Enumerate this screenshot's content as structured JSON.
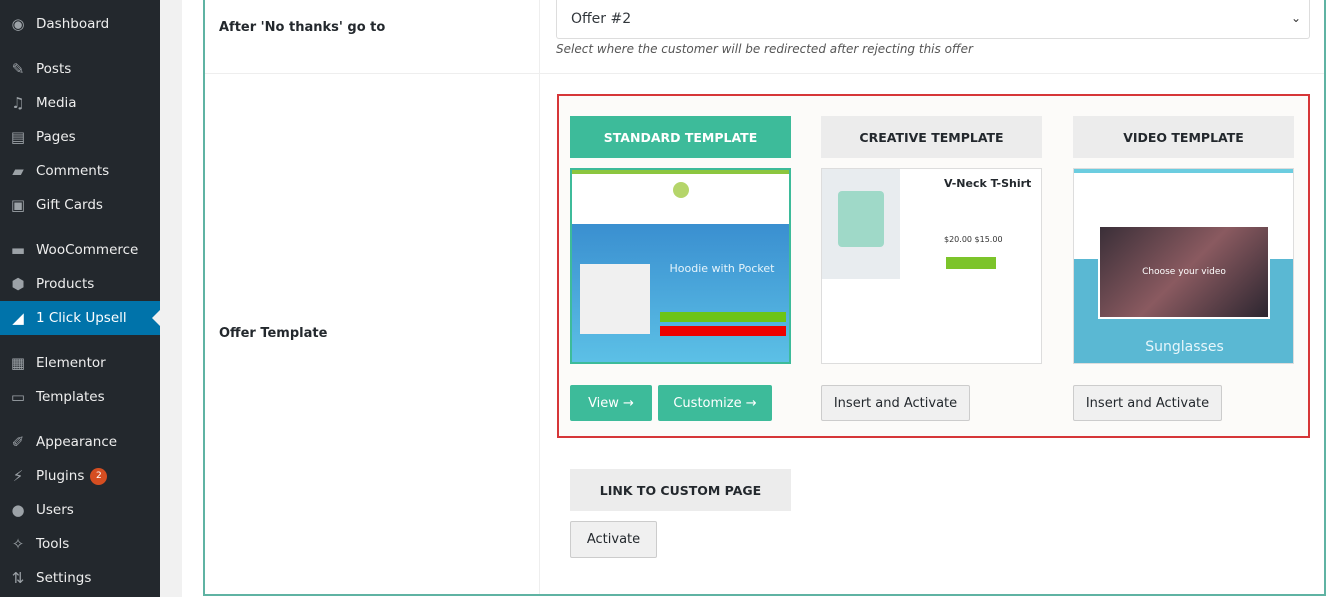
{
  "sidebar": {
    "items": [
      {
        "label": "Dashboard",
        "icon": "dashboard-icon",
        "glyph": "◉"
      },
      {
        "label": "Posts",
        "icon": "pin-icon",
        "glyph": "✎"
      },
      {
        "label": "Media",
        "icon": "media-icon",
        "glyph": "♫"
      },
      {
        "label": "Pages",
        "icon": "pages-icon",
        "glyph": "▤"
      },
      {
        "label": "Comments",
        "icon": "comment-icon",
        "glyph": "▰"
      },
      {
        "label": "Gift Cards",
        "icon": "gift-card-icon",
        "glyph": "▣"
      },
      {
        "label": "WooCommerce",
        "icon": "woo-icon",
        "glyph": "▬"
      },
      {
        "label": "Products",
        "icon": "box-icon",
        "glyph": "⬢"
      },
      {
        "label": "1 Click Upsell",
        "icon": "chart-icon",
        "glyph": "◢",
        "active": true
      },
      {
        "label": "Elementor",
        "icon": "elementor-icon",
        "glyph": "▦"
      },
      {
        "label": "Templates",
        "icon": "folder-icon",
        "glyph": "▭"
      },
      {
        "label": "Appearance",
        "icon": "brush-icon",
        "glyph": "✐"
      },
      {
        "label": "Plugins",
        "icon": "plugin-icon",
        "glyph": "⚡",
        "badge": "2"
      },
      {
        "label": "Users",
        "icon": "user-icon",
        "glyph": "●"
      },
      {
        "label": "Tools",
        "icon": "wrench-icon",
        "glyph": "✧"
      },
      {
        "label": "Settings",
        "icon": "settings-icon",
        "glyph": "⇅"
      }
    ]
  },
  "form": {
    "no_thanks_label": "After 'No thanks' go to",
    "no_thanks_value": "Offer #2",
    "no_thanks_desc": "Select where the customer will be redirected after rejecting this offer",
    "template_label": "Offer Template"
  },
  "templates": [
    {
      "title": "STANDARD TEMPLATE",
      "selected": true,
      "buttons": [
        "View →",
        "Customize →"
      ],
      "thumb_text": "Hoodie with Pocket"
    },
    {
      "title": "CREATIVE TEMPLATE",
      "selected": false,
      "buttons": [
        "Insert and Activate"
      ],
      "thumb_text": "V-Neck T-Shirt",
      "thumb_price": "$20.00 $15.00"
    },
    {
      "title": "VIDEO TEMPLATE",
      "selected": false,
      "buttons": [
        "Insert and Activate"
      ],
      "thumb_text": "Sunglasses",
      "thumb_video": "Choose your video"
    }
  ],
  "custom_page": {
    "title": "LINK TO CUSTOM PAGE",
    "button": "Activate"
  },
  "colors": {
    "accent": "#3dbb9a",
    "highlight": "#d63638",
    "sidebar": "#23282d",
    "active": "#0073aa"
  }
}
